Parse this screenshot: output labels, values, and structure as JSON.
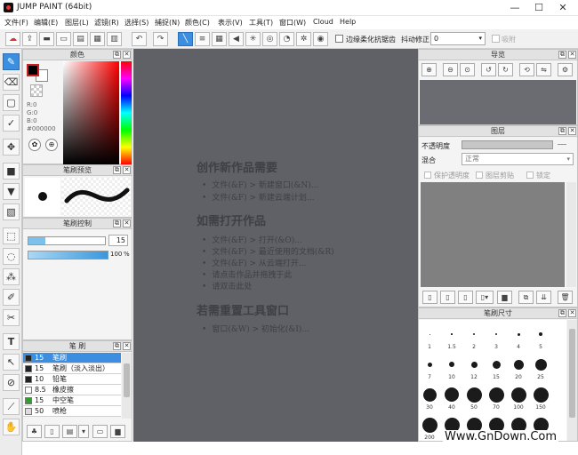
{
  "window": {
    "title": "JUMP PAINT (64bit)",
    "min": "—",
    "max": "☐",
    "close": "✕"
  },
  "menu": [
    "文件(F)",
    "编辑(E)",
    "图层(L)",
    "滤镜(R)",
    "选择(S)",
    "捕捉(N)",
    "颜色(C)",
    "表示(V)",
    "工具(T)",
    "窗口(W)",
    "Cloud",
    "Help"
  ],
  "toolbar": {
    "antialias_label": "边缘柔化抗锯齿",
    "stabilizer_label": "抖动修正",
    "stabilizer_value": "0",
    "snap_label": "吸附"
  },
  "color_panel": {
    "title": "颜色",
    "r": "R:0",
    "g": "G:0",
    "b": "B:0",
    "hex": "#000000",
    "fg": "#000000",
    "bg": "#ffffff"
  },
  "brush_preview": {
    "title": "笔刷预览"
  },
  "brush_control": {
    "title": "笔刷控制",
    "size_value": "15",
    "opacity_value": "100",
    "opacity_unit": "%",
    "size_fill": 0.22,
    "opacity_fill": 1.0
  },
  "brush_list": {
    "title": "笔 刷",
    "items": [
      {
        "size": "15",
        "name": "笔刷",
        "color": "#222222",
        "selected": true
      },
      {
        "size": "15",
        "name": "笔刷（淡入淡出）",
        "color": "#222222",
        "selected": false
      },
      {
        "size": "10",
        "name": "铅笔",
        "color": "#222222",
        "selected": false
      },
      {
        "size": "8.5",
        "name": "橡皮擦",
        "color": "#ffffff",
        "selected": false
      },
      {
        "size": "15",
        "name": "中空笔",
        "color": "#2e9e2e",
        "selected": false
      },
      {
        "size": "50",
        "name": "喷枪",
        "color": "#dddddd",
        "selected": false
      }
    ]
  },
  "canvas": {
    "new_title": "创作新作品需要",
    "new_items": [
      "文件(&F) > 新建窗口(&N)...",
      "文件(&F) > 新建云端计划..."
    ],
    "open_title": "如需打开作品",
    "open_items": [
      "文件(&F) > 打开(&O)...",
      "文件(&F) > 最近使用的文档(&R)",
      "文件(&F) > 从云端打开...",
      "请点击作品并拖拽于此",
      "请双击此处"
    ],
    "reset_title": "若需重置工具窗口",
    "reset_items": [
      "窗口(&W) > 初始化(&I)..."
    ]
  },
  "navigator": {
    "title": "导览"
  },
  "layers": {
    "title": "图层",
    "opacity_label": "不透明度",
    "blend_label": "混合",
    "blend_value": "正常",
    "protect_alpha": "保护透明度",
    "clipping": "图层剪贴",
    "lock": "锁定"
  },
  "brush_size": {
    "title": "笔刷尺寸",
    "sizes": [
      "1",
      "1.5",
      "2",
      "3",
      "4",
      "5",
      "7",
      "10",
      "12",
      "15",
      "20",
      "25",
      "30",
      "40",
      "50",
      "70",
      "100",
      "150",
      "200",
      "300",
      "400",
      "500",
      "700",
      "1000"
    ]
  },
  "watermark": "Www.GnDown.Com"
}
